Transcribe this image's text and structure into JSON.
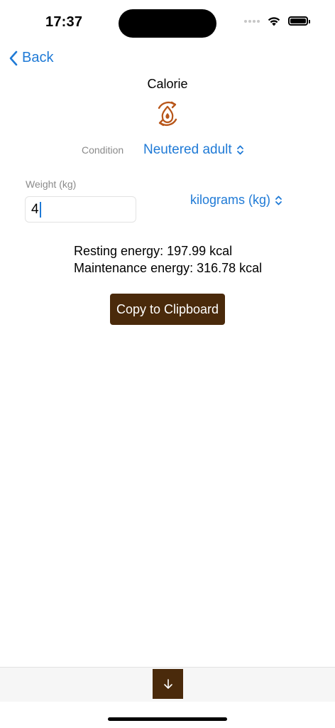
{
  "status_bar": {
    "time": "17:37"
  },
  "nav": {
    "back_label": "Back"
  },
  "page": {
    "title": "Calorie",
    "icon": "calorie-cycle-icon",
    "accent_color": "#1f7ad6",
    "brand_color": "#4a2a0b"
  },
  "condition": {
    "label": "Condition",
    "value": "Neutered adult"
  },
  "weight": {
    "label": "Weight (kg)",
    "value": "4",
    "unit": "kilograms (kg)"
  },
  "results": {
    "resting": "Resting energy: 197.99 kcal",
    "maintenance": "Maintenance energy: 316.78 kcal"
  },
  "actions": {
    "copy_label": "Copy to Clipboard"
  }
}
